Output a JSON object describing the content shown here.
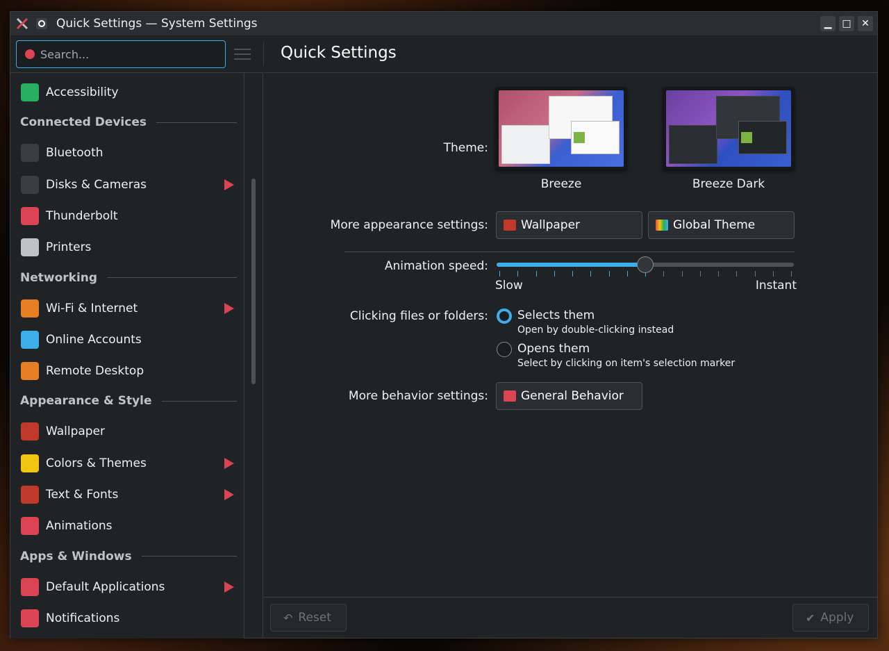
{
  "window": {
    "title": "Quick Settings — System Settings",
    "controls": {
      "minimize": "▁",
      "maximize": "□",
      "close": "✕"
    }
  },
  "search": {
    "placeholder": "Search..."
  },
  "sidebar": {
    "items": [
      {
        "type": "item",
        "label": "Accessibility",
        "icon": "accessibility-icon",
        "color": "#27ae60",
        "has_arrow": false
      },
      {
        "type": "category",
        "label": "Connected Devices"
      },
      {
        "type": "item",
        "label": "Bluetooth",
        "icon": "tools-icon",
        "color": "#3a3e42",
        "has_arrow": false
      },
      {
        "type": "item",
        "label": "Disks & Cameras",
        "icon": "tools-icon",
        "color": "#3a3e42",
        "has_arrow": true
      },
      {
        "type": "item",
        "label": "Thunderbolt",
        "icon": "missing-icon",
        "color": "#da4453",
        "has_arrow": false
      },
      {
        "type": "item",
        "label": "Printers",
        "icon": "printer-icon",
        "color": "#bdc3c7",
        "has_arrow": false
      },
      {
        "type": "category",
        "label": "Networking"
      },
      {
        "type": "item",
        "label": "Wi-Fi & Internet",
        "icon": "network-icon",
        "color": "#e67e22",
        "has_arrow": true
      },
      {
        "type": "item",
        "label": "Online Accounts",
        "icon": "globe-icon",
        "color": "#3daee9",
        "has_arrow": false
      },
      {
        "type": "item",
        "label": "Remote Desktop",
        "icon": "network-icon",
        "color": "#e67e22",
        "has_arrow": false
      },
      {
        "type": "category",
        "label": "Appearance & Style"
      },
      {
        "type": "item",
        "label": "Wallpaper",
        "icon": "wallpaper-icon",
        "color": "#c0392b",
        "has_arrow": false
      },
      {
        "type": "item",
        "label": "Colors & Themes",
        "icon": "color-palette-icon",
        "color": "#f1c40f",
        "has_arrow": true
      },
      {
        "type": "item",
        "label": "Text & Fonts",
        "icon": "font-icon",
        "color": "#c0392b",
        "has_arrow": true
      },
      {
        "type": "item",
        "label": "Animations",
        "icon": "missing-icon",
        "color": "#da4453",
        "has_arrow": false
      },
      {
        "type": "category",
        "label": "Apps & Windows"
      },
      {
        "type": "item",
        "label": "Default Applications",
        "icon": "missing-icon",
        "color": "#da4453",
        "has_arrow": true
      },
      {
        "type": "item",
        "label": "Notifications",
        "icon": "missing-icon",
        "color": "#da4453",
        "has_arrow": false
      }
    ]
  },
  "page": {
    "title": "Quick Settings",
    "theme_label": "Theme:",
    "themes": [
      {
        "name": "Breeze",
        "selected": false
      },
      {
        "name": "Breeze Dark",
        "selected": true
      }
    ],
    "more_appearance_label": "More appearance settings:",
    "wallpaper_button": "Wallpaper",
    "global_theme_button": "Global Theme",
    "animation_label": "Animation speed:",
    "animation_speed": {
      "value": 0.5,
      "min_label": "Slow",
      "max_label": "Instant",
      "steps": 17
    },
    "clicking_label": "Clicking files or folders:",
    "click_options": [
      {
        "label": "Selects them",
        "desc": "Open by double-clicking instead",
        "checked": true
      },
      {
        "label": "Opens them",
        "desc": "Select by clicking on item's selection marker",
        "checked": false
      }
    ],
    "more_behavior_label": "More behavior settings:",
    "general_behavior_button": "General Behavior"
  },
  "footer": {
    "reset_label": "Reset",
    "apply_label": "Apply"
  },
  "colors": {
    "accent": "#3daee9",
    "window_bg": "#202326",
    "text": "#fcfcfc"
  }
}
